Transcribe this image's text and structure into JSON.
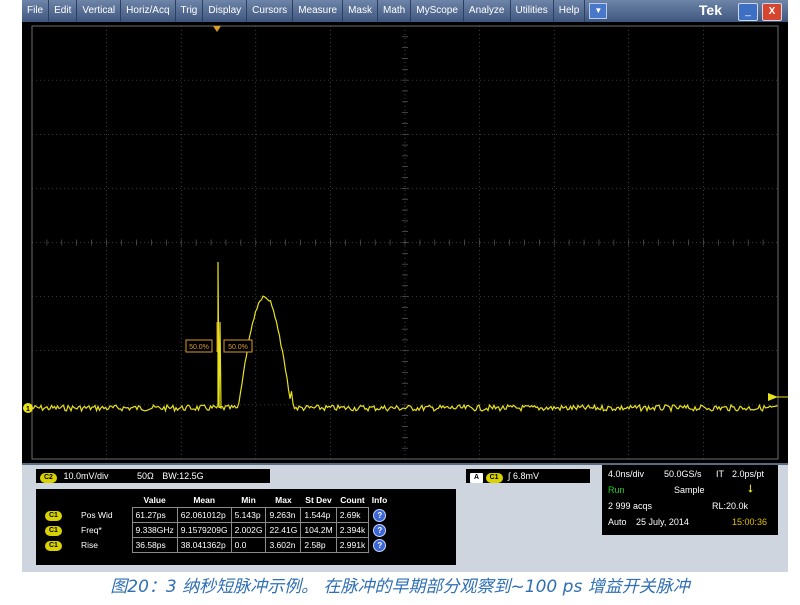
{
  "menu": {
    "items": [
      "File",
      "Edit",
      "Vertical",
      "Horiz/Acq",
      "Trig",
      "Display",
      "Cursors",
      "Measure",
      "Mask",
      "Math",
      "MyScope",
      "Analyze",
      "Utilities",
      "Help"
    ],
    "brand": "Tek",
    "minimize": "_",
    "close": "X",
    "dropdown": "▼"
  },
  "screen": {
    "cursor_label_left": "50.0%",
    "cursor_label_right": "50.0%",
    "channel_marker": "1"
  },
  "channel_info": {
    "badge": "C2",
    "scale": "10.0mV/div",
    "impedance": "50Ω",
    "bw": "BW:12.5G"
  },
  "trigger_info": {
    "mode_badge": "A",
    "source_badge": "C1",
    "level": "6.8mV",
    "slope_icon": "rising-edge-icon"
  },
  "acquisition": {
    "timebase": "4.0ns/div",
    "sample_rate": "50.0GS/s",
    "it": "IT",
    "resolution": "2.0ps/pt",
    "state": "Run",
    "mode": "Sample",
    "acqs": "2 999 acqs",
    "record_length": "RL:20.0k",
    "trigger_mode": "Auto",
    "date": "25 July, 2014",
    "time": "15:00:36"
  },
  "measurements": {
    "headers": [
      "Value",
      "Mean",
      "Min",
      "Max",
      "St Dev",
      "Count",
      "Info"
    ],
    "rows": [
      {
        "badge": "C1",
        "name": "Pos Wid",
        "value": "61.27ps",
        "mean": "62.061012p",
        "min": "5.143p",
        "max": "9.263n",
        "stdev": "1.544p",
        "count": "2.69k"
      },
      {
        "badge": "C1",
        "name": "Freq*",
        "value": "9.338GHz",
        "mean": "9.1579209G",
        "min": "2.002G",
        "max": "22.41G",
        "stdev": "104.2M",
        "count": "2.394k"
      },
      {
        "badge": "C1",
        "name": "Rise",
        "value": "36.58ps",
        "mean": "38.041362p",
        "min": "0.0",
        "max": "3.602n",
        "stdev": "2.58p",
        "count": "2.991k"
      }
    ]
  },
  "caption": "图20：3 纳秒短脉冲示例。 在脉冲的早期部分观察到~100 ps 增益开关脉冲",
  "colors": {
    "trace": "#e8e21a",
    "grid": "#6b6b6b",
    "cursor": "#d99a2b",
    "run": "#1fd01f",
    "time": "#e0c000"
  }
}
